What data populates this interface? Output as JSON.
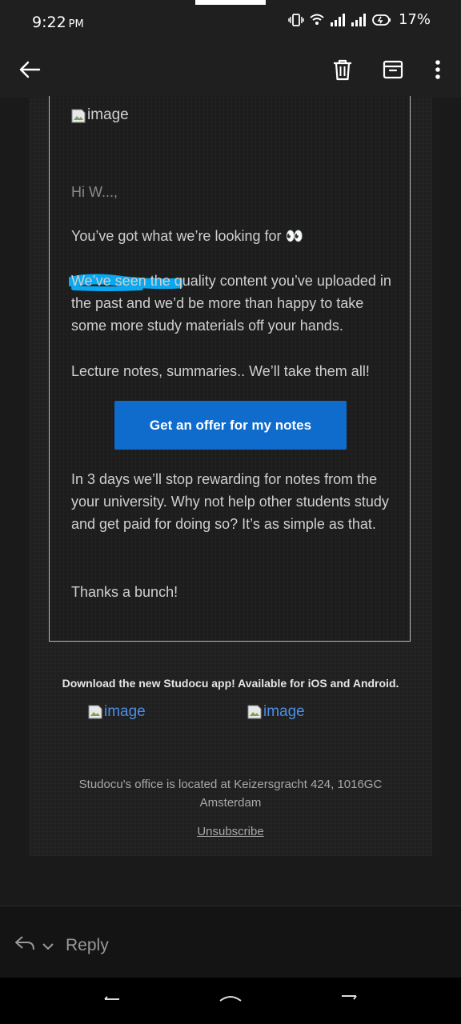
{
  "status_bar": {
    "time": "9:22",
    "ampm": "PM",
    "battery": "17%"
  },
  "toolbar": {
    "back_icon": "arrow-left-icon",
    "delete_icon": "trash-icon",
    "archive_icon": "archive-icon",
    "more_icon": "more-vertical-icon"
  },
  "email": {
    "header_image_alt": "image",
    "greeting": "Hi W...,",
    "line1": "You’ve got what we’re looking for 👀",
    "paragraph1": "We’ve seen the quality content you’ve uploaded in the past and we’d be more than happy to take some more study materials off your hands.",
    "paragraph2": "Lecture notes, summaries.. We’ll take them all!",
    "cta_label": "Get an offer for my notes",
    "paragraph3": "In 3 days we’ll stop rewarding for notes from the your university. Why not help other students study and get paid for doing so? It’s as simple as that.",
    "signoff": "Thanks a bunch!",
    "download_text": "Download the new Studocu app! Available for iOS and Android.",
    "ios_image_alt": "image",
    "android_image_alt": "image",
    "office_text": "Studocu's office is located at Keizersgracht 424, 1016GC Amsterdam",
    "unsubscribe": "Unsubscribe"
  },
  "reply_bar": {
    "reply_label": "Reply"
  },
  "colors": {
    "accent": "#0f6ccc",
    "redaction": "#0aa8f0"
  }
}
